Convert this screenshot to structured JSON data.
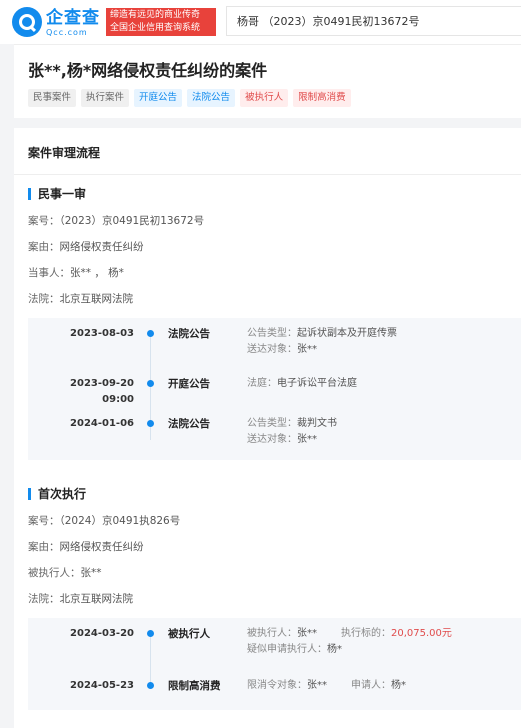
{
  "header": {
    "logo_cn": "企查查",
    "logo_en": "Qcc.com",
    "slogan_line1": "缔造有远见的商业传奇",
    "slogan_line2": "全国企业信用查询系统",
    "search_value": "杨哥 （2023）京0491民初13672号"
  },
  "case": {
    "title": "张**,杨*网络侵权责任纠纷的案件",
    "tags": [
      {
        "label": "民事案件",
        "style": "gray"
      },
      {
        "label": "执行案件",
        "style": "gray"
      },
      {
        "label": "开庭公告",
        "style": "blue"
      },
      {
        "label": "法院公告",
        "style": "blue"
      },
      {
        "label": "被执行人",
        "style": "red"
      },
      {
        "label": "限制高消费",
        "style": "red"
      }
    ]
  },
  "process": {
    "title": "案件审理流程",
    "first_trial": {
      "title": "民事一审",
      "case_no_label": "案号：",
      "case_no": "（2023）京0491民初13672号",
      "cause_label": "案由：",
      "cause": "网络侵权责任纠纷",
      "parties_label": "当事人：",
      "parties": "张** ， 杨*",
      "court_label": "法院：",
      "court": "北京互联网法院",
      "events": [
        {
          "date": "2023-08-03",
          "type": "法院公告",
          "line1_label": "公告类型：",
          "line1_value": "起诉状副本及开庭传票",
          "line2_label": "送达对象：",
          "line2_value": "张**"
        },
        {
          "date": "2023-09-20",
          "time": "09:00",
          "type": "开庭公告",
          "line1_label": "法庭：",
          "line1_value": "电子诉讼平台法庭"
        },
        {
          "date": "2024-01-06",
          "type": "法院公告",
          "line1_label": "公告类型：",
          "line1_value": "裁判文书",
          "line2_label": "送达对象：",
          "line2_value": "张**"
        }
      ]
    },
    "execution": {
      "title": "首次执行",
      "case_no_label": "案号：",
      "case_no": "（2024）京0491执826号",
      "cause_label": "案由：",
      "cause": "网络侵权责任纠纷",
      "executed_label": "被执行人：",
      "executed": "张**",
      "court_label": "法院：",
      "court": "北京互联网法院",
      "events": [
        {
          "date": "2024-03-20",
          "type": "被执行人",
          "line1_label": "被执行人：",
          "line1_value": "张**",
          "amount_label": "执行标的：",
          "amount_value": "20,075.00元",
          "line2_label": "疑似申请执行人：",
          "line2_value": "杨*"
        },
        {
          "date": "2024-05-23",
          "type": "限制高消费",
          "line1_label": "限消令对象：",
          "line1_value": "张**",
          "applicant_label": "申请人：",
          "applicant_value": "杨*"
        }
      ]
    }
  },
  "colors": {
    "brand": "#128bed",
    "slogan_bg": "#e8423b",
    "money": "#e04c4c"
  }
}
